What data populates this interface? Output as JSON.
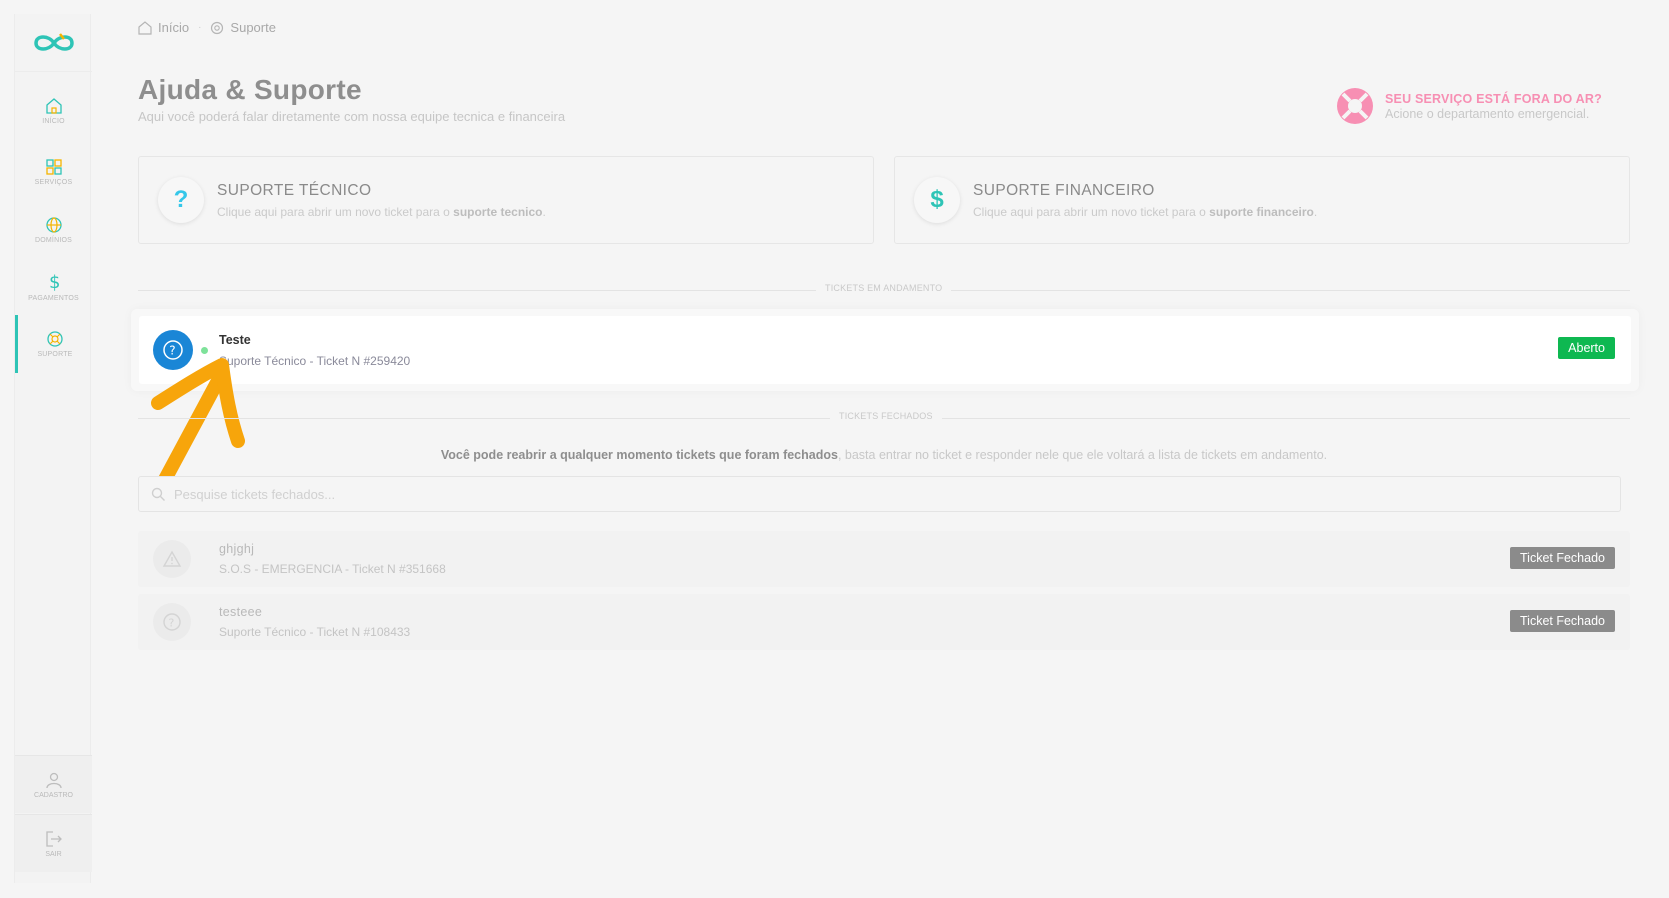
{
  "sidebar": {
    "items": [
      {
        "label": "INÍCIO",
        "icon": "home-icon"
      },
      {
        "label": "SERVIÇOS",
        "icon": "grid-icon"
      },
      {
        "label": "DOMÍNIOS",
        "icon": "globe-icon"
      },
      {
        "label": "PAGAMENTOS",
        "icon": "dollar-icon"
      },
      {
        "label": "SUPORTE",
        "icon": "lifebuoy-icon"
      }
    ],
    "bottom": [
      {
        "label": "CADASTRO",
        "icon": "user-icon"
      },
      {
        "label": "SAIR",
        "icon": "logout-icon"
      }
    ],
    "accent": "#2ec4b6"
  },
  "breadcrumb": {
    "home": "Início",
    "current": "Suporte"
  },
  "header": {
    "title": "Ajuda & Suporte",
    "subtitle": "Aqui você poderá falar diretamente com nossa equipe tecnica e financeira"
  },
  "emergency": {
    "title": "SEU SERVIÇO ESTÁ FORA DO AR?",
    "subtitle": "Acione o departamento emergencial.",
    "color": "#f78fb3"
  },
  "cards": {
    "tech": {
      "title": "SUPORTE TÉCNICO",
      "desc_prefix": "Clique aqui para abrir um novo ticket para o ",
      "desc_bold": "suporte tecnico",
      "desc_suffix": ".",
      "icon": "question-icon"
    },
    "finance": {
      "title": "SUPORTE FINANCEIRO",
      "desc_prefix": "Clique aqui para abrir um novo ticket para o ",
      "desc_bold": "suporte financeiro",
      "desc_suffix": ".",
      "icon": "dollar-icon"
    }
  },
  "sections": {
    "open": "TICKETS EM ANDAMENTO",
    "closed": "TICKETS FECHADOS"
  },
  "open_tickets": [
    {
      "title": "Teste",
      "subtitle": "Suporte Técnico - Ticket N #259420",
      "status": "Aberto",
      "status_color": "#0eb851"
    }
  ],
  "reopen_info": {
    "bold": "Você pode reabrir a qualquer momento tickets que foram fechados",
    "rest": ", basta entrar no ticket e responder nele que ele voltará a lista de tickets em andamento."
  },
  "search": {
    "placeholder": "Pesquise tickets fechados..."
  },
  "closed_tickets": [
    {
      "title": "ghjghj",
      "subtitle": "S.O.S - EMERGENCIA - Ticket N #351668",
      "status": "Ticket Fechado",
      "icon": "warning-icon"
    },
    {
      "title": "testeee",
      "subtitle": "Suporte Técnico - Ticket N #108433",
      "status": "Ticket Fechado",
      "icon": "question-icon"
    }
  ]
}
